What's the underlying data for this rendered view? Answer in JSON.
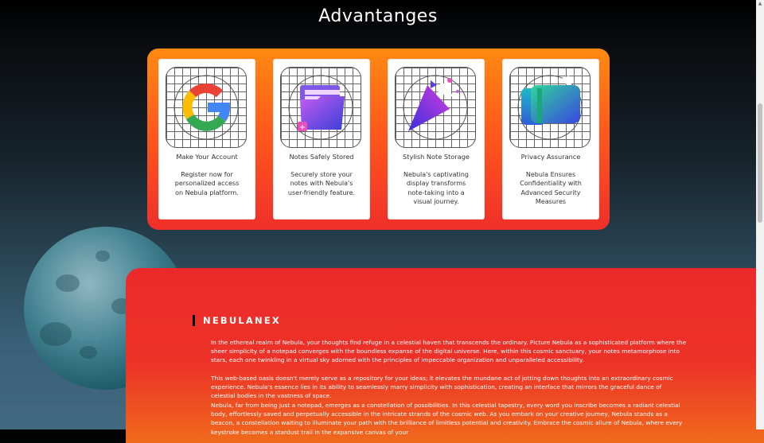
{
  "page": {
    "title": "Advantanges"
  },
  "cards": [
    {
      "title": "Make Your Account",
      "desc": "Register now for personalized access on Nebula platform.",
      "icon": "google-g-icon"
    },
    {
      "title": "Notes Safely Stored",
      "desc": "Securely store your notes with Nebula's user-friendly feature.",
      "icon": "folder-icon"
    },
    {
      "title": "Stylish Note Storage",
      "desc": "Nebula's captivating display transforms note-taking into a visual journey.",
      "icon": "party-popper-icon"
    },
    {
      "title": "Privacy Assurance",
      "desc": "Nebula Ensures Confidentiality with Advanced Security Measures",
      "icon": "wallet-icon"
    }
  ],
  "about": {
    "brand": "NEBULANEX",
    "paragraphs": [
      "In the ethereal realm of Nebula, your thoughts find refuge in a celestial haven that transcends the ordinary. Picture Nebula as a sophisticated platform where the sheer simplicity of a notepad converges with the boundless expanse of the digital universe. Here, within this cosmic sanctuary, your notes metamorphose into stars, each one twinkling in a virtual sky adorned with the principles of impeccable organization and unparalleled accessibility.",
      "This web-based oasis doesn't merely serve as a repository for your ideas; it elevates the mundane act of jotting down thoughts into an extraordinary cosmic experience. Nebula's essence lies in its ability to seamlessly marry simplicity with sophistication, creating an interface that mirrors the graceful dance of celestial bodies in the vastness of space.",
      "Nebula, far from being just a notepad, emerges as a constellation of possibilities. In this celestial tapestry, every word you inscribe becomes a radiant celestial body, effortlessly saved and perpetually accessible in the intricate strands of the cosmic web. As you embark on your creative journey, Nebula stands as a beacon, a constellation waiting to illuminate your path with the brilliance of limitless potential and creativity. Embrace the cosmic allure of Nebula, where every keystroke becomes a stardust trail in the expansive canvas of your"
    ]
  },
  "colors": {
    "panel_top": "#ff8a10",
    "panel_bottom": "#ef2f2a",
    "section": "#ea2a2a"
  }
}
